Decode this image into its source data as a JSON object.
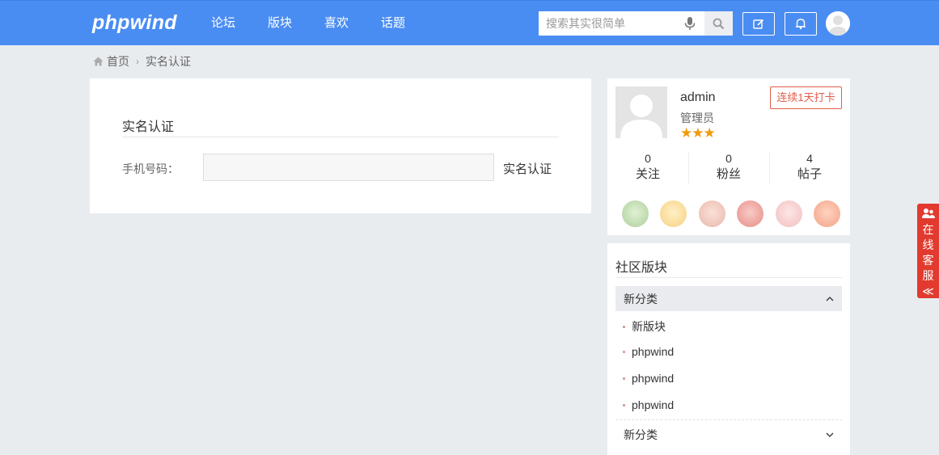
{
  "header": {
    "logo": "phpwind",
    "nav": [
      "论坛",
      "版块",
      "喜欢",
      "话题"
    ],
    "search_placeholder": "搜索其实很简单"
  },
  "breadcrumb": {
    "home": "首页",
    "current": "实名认证"
  },
  "main": {
    "title": "实名认证",
    "phone_label": "手机号码：",
    "phone_value": "",
    "submit_label": "实名认证"
  },
  "user": {
    "name": "admin",
    "role": "管理员",
    "stars": "★★★",
    "checkin_label": "连续1天打卡",
    "stats": [
      {
        "count": "0",
        "label": "关注"
      },
      {
        "count": "0",
        "label": "粉丝"
      },
      {
        "count": "4",
        "label": "帖子"
      }
    ],
    "medal_icons": [
      "medal-face-icon",
      "medal-sunglasses-icon",
      "medal-sofa-icon",
      "medal-loyal-icon",
      "medal-lips-icon",
      "medal-rich-icon"
    ]
  },
  "forum": {
    "title": "社区版块",
    "categories": [
      {
        "name": "新分类",
        "expanded": true,
        "items": [
          "新版块",
          "phpwind",
          "phpwind",
          "phpwind"
        ]
      },
      {
        "name": "新分类",
        "expanded": false,
        "items": []
      }
    ]
  },
  "service": {
    "label_chars": [
      "在",
      "线",
      "客",
      "服"
    ],
    "collapse_glyph": "≪"
  },
  "colors": {
    "header_bg": "#4a8df2",
    "page_bg": "#e9ecef",
    "accent_red": "#e25d4a",
    "star": "#f29a0b",
    "service_bg": "#e23a2e"
  }
}
